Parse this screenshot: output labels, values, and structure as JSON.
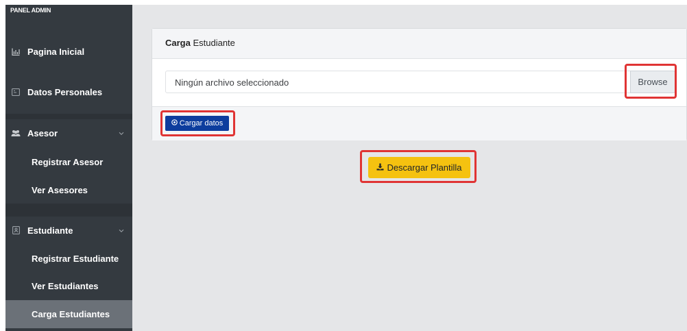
{
  "sidebar": {
    "brand": "PANEL ADMIN",
    "items": [
      {
        "label": "Pagina Inicial",
        "icon": "bar-chart-icon"
      },
      {
        "label": "Datos Personales",
        "icon": "id-card-icon"
      },
      {
        "label": "Asesor",
        "icon": "users-icon"
      },
      {
        "label": "Registrar Asesor"
      },
      {
        "label": "Ver Asesores"
      },
      {
        "label": "Estudiante",
        "icon": "contact-book-icon"
      },
      {
        "label": "Registrar Estudiante"
      },
      {
        "label": "Ver Estudiantes"
      },
      {
        "label": "Carga Estudiantes"
      }
    ],
    "active_item": "Carga Estudiantes"
  },
  "card": {
    "title_bold": "Carga",
    "title_rest": " Estudiante",
    "file_placeholder": "Ningún archivo seleccionado",
    "browse_label": "Browse",
    "upload_label": "Cargar datos"
  },
  "download_label": "Descargar Plantilla",
  "colors": {
    "sidebar_bg": "#343a40",
    "active_bg": "#6b7178",
    "primary": "#0d3d9e",
    "warning": "#f5c210",
    "highlight": "#e03434"
  }
}
